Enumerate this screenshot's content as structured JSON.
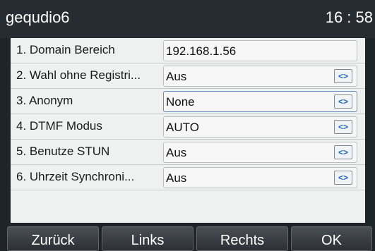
{
  "statusbar": {
    "title": "gequdio6",
    "time": "16 : 58"
  },
  "settings": [
    {
      "label": "1. Domain Bereich",
      "value": "192.168.1.56",
      "has_dropdown": false
    },
    {
      "label": "2. Wahl ohne Registri...",
      "value": "Aus",
      "has_dropdown": true,
      "icon": "dropdown-arrows-icon"
    },
    {
      "label": "3. Anonym",
      "value": "None",
      "has_dropdown": true,
      "selected": true,
      "icon": "dropdown-arrows-icon"
    },
    {
      "label": "4. DTMF Modus",
      "value": "AUTO",
      "has_dropdown": true,
      "icon": "dropdown-arrows-icon"
    },
    {
      "label": "5. Benutze STUN",
      "value": "Aus",
      "has_dropdown": true,
      "icon": "dropdown-arrows-icon"
    },
    {
      "label": "6. Uhrzeit Synchroni...",
      "value": "Aus",
      "has_dropdown": true,
      "icon": "dropdown-arrows-icon"
    }
  ],
  "dropdown_glyph": "<>",
  "softkeys": {
    "back": "Zurück",
    "left": "Links",
    "right": "Rechts",
    "ok": "OK"
  },
  "colors": {
    "selected_border": "#5a8dc7",
    "arrow_color": "#1c66b9",
    "statusbar_bg": "#272c30"
  }
}
